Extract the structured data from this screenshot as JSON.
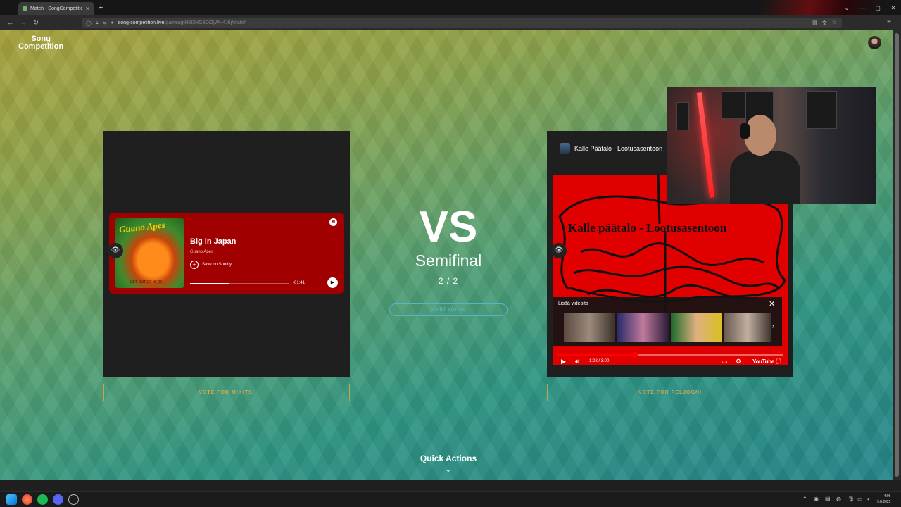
{
  "browser": {
    "tab_title": "Match - SongCompetition",
    "tab_close": "✕",
    "new_tab": "+",
    "url_host": "song-competition.live",
    "url_path": "/game/igtH8t3HG9OIZjWH4J6j/match"
  },
  "site": {
    "logo_line1": "Song",
    "logo_line2": "Competition"
  },
  "left_entry": {
    "spotify": {
      "album_cover_text": "Guano Apes",
      "album_cover_subtext": "GET OUT OF HERE",
      "track": "Big in Japan",
      "artist": "Guano Apes",
      "save_label": "Save on Spotify",
      "remaining": "-01:41",
      "progress": 0.39
    },
    "vote_label": "VOTE FOR MIKITSI"
  },
  "match": {
    "vs": "VS",
    "round": "Semifinal",
    "progress": "2 / 2",
    "start_voting": "START VOTING"
  },
  "right_entry": {
    "youtube": {
      "title": "Kalle Päätalo - Lootusasentoon",
      "video_text": "Kalle päätalo - Lootusasentoon",
      "more_videos": "Lisää videoita",
      "time": "1:02 / 3:00",
      "progress": 0.344,
      "logo": "YouTube"
    },
    "vote_label": "VOTE FOR PELJOGNI"
  },
  "quick_actions": "Quick Actions",
  "taskbar": {
    "time": "4:06",
    "date": "9.8.2025"
  },
  "colors": {
    "spotify_card": "#a00000",
    "start_voting": "#4fb7c7",
    "vote_button": "#cfab53",
    "youtube_red": "#e00000"
  }
}
